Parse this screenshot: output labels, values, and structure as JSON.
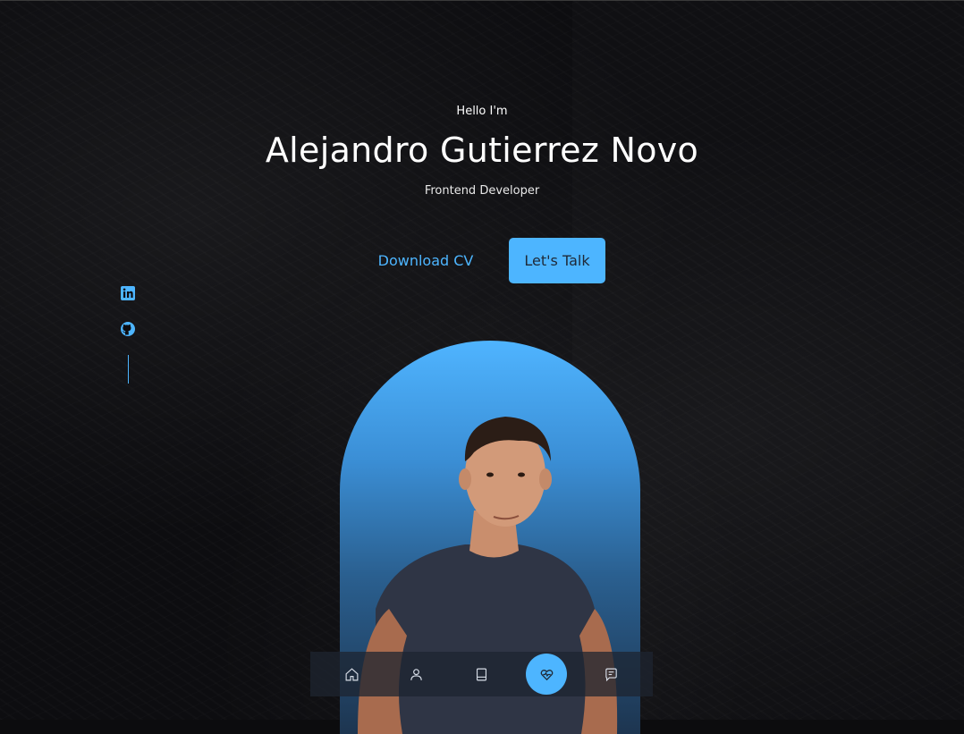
{
  "header": {
    "greeting": "Hello I'm",
    "name": "Alejandro Gutierrez Novo",
    "role": "Frontend Developer"
  },
  "cta": {
    "download_label": "Download CV",
    "talk_label": "Let's Talk"
  },
  "social": [
    {
      "icon": "linkedin-icon"
    },
    {
      "icon": "github-icon"
    }
  ],
  "nav": {
    "items": [
      {
        "icon": "home-icon",
        "active": false
      },
      {
        "icon": "user-icon",
        "active": false
      },
      {
        "icon": "book-icon",
        "active": false
      },
      {
        "icon": "heart-icon",
        "active": true
      },
      {
        "icon": "message-icon",
        "active": false
      }
    ]
  },
  "colors": {
    "accent": "#4db5ff",
    "background": "#0d0d10",
    "text": "#ffffff"
  }
}
